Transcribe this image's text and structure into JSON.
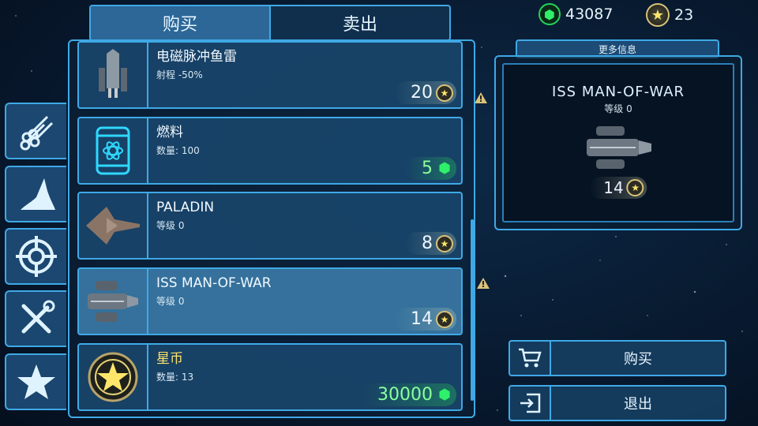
{
  "tabs": {
    "buy": "购买",
    "sell": "卖出"
  },
  "currency": {
    "gems": "43087",
    "stars": "23"
  },
  "categories": [
    "ammo-icon",
    "wing-icon",
    "target-icon",
    "tools-icon",
    "star-icon"
  ],
  "items": [
    {
      "name": "电磁脉冲鱼雷",
      "sub": "射程 -50%",
      "price": "20",
      "currency": "star"
    },
    {
      "name": "燃料",
      "sub": "数量: 100",
      "price": "5",
      "currency": "gem"
    },
    {
      "name": "PALADIN",
      "sub": "等级 0",
      "price": "8",
      "currency": "star"
    },
    {
      "name": "ISS MAN-OF-WAR",
      "sub": "等级 0",
      "price": "14",
      "currency": "star",
      "selected": true
    },
    {
      "name": "星币",
      "sub": "数量: 13",
      "price": "30000",
      "currency": "gem"
    }
  ],
  "detail": {
    "more_info": "更多信息",
    "name": "ISS MAN-OF-WAR",
    "level": "等级 0",
    "price": "14"
  },
  "actions": {
    "buy": "购买",
    "exit": "退出"
  },
  "colors": {
    "accent": "#3fa9e6",
    "gem": "#2ff06a",
    "star": "#ffe66b"
  }
}
